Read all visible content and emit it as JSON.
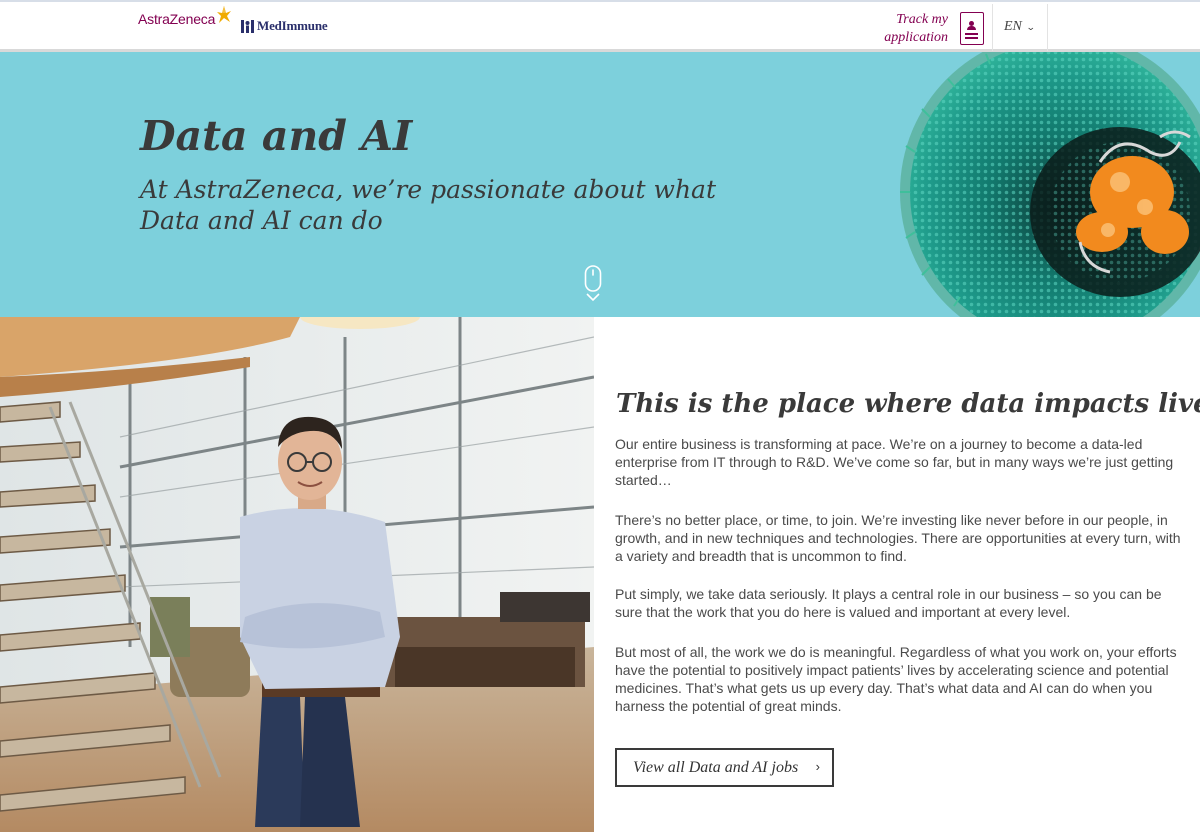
{
  "header": {
    "brand_primary": "AstraZeneca",
    "brand_secondary": "MedImmune",
    "track_label_line1": "Track my",
    "track_label_line2": "application",
    "language": "EN",
    "icons": [
      "astrazeneca-logo-icon",
      "medimmune-logo-icon",
      "application-form-icon",
      "chevron-down-icon"
    ]
  },
  "hero": {
    "title": "Data and AI",
    "subtitle": "At AstraZeneca, we’re passionate about what Data and AI can do",
    "background_color": "#7dd0dc",
    "icons": [
      "scroll-mouse-icon",
      "virus-illustration"
    ]
  },
  "section": {
    "title": "This is the place where data impacts lives",
    "paragraphs": [
      "Our entire business is transforming at pace. We’re on a journey to become a data-led enterprise from IT through to R&D. We’ve come so far, but in many ways we’re just getting started…",
      "There’s no better place, or time, to join. We’re investing like never before in our people, in growth, and in new techniques and technologies. There are opportunities at every turn, with a variety and breadth that is uncommon to find.",
      "Put simply, we take data seriously. It plays a central role in our business – so you can be sure that the work that you do here is valued and important at every level.",
      "But most of all, the work we do is meaningful. Regardless of what you work on, your efforts have the potential to positively impact patients’ lives by accelerating science and potential medicines. That’s what gets us up every day. That’s what data and AI can do when you harness the potential of great minds."
    ],
    "cta_label": "View all Data and AI jobs"
  },
  "colors": {
    "brand_magenta": "#830051",
    "medimmune_navy": "#2a2f6b",
    "hero_teal": "#7dd0dc",
    "text_dark": "#3a3a3a"
  }
}
